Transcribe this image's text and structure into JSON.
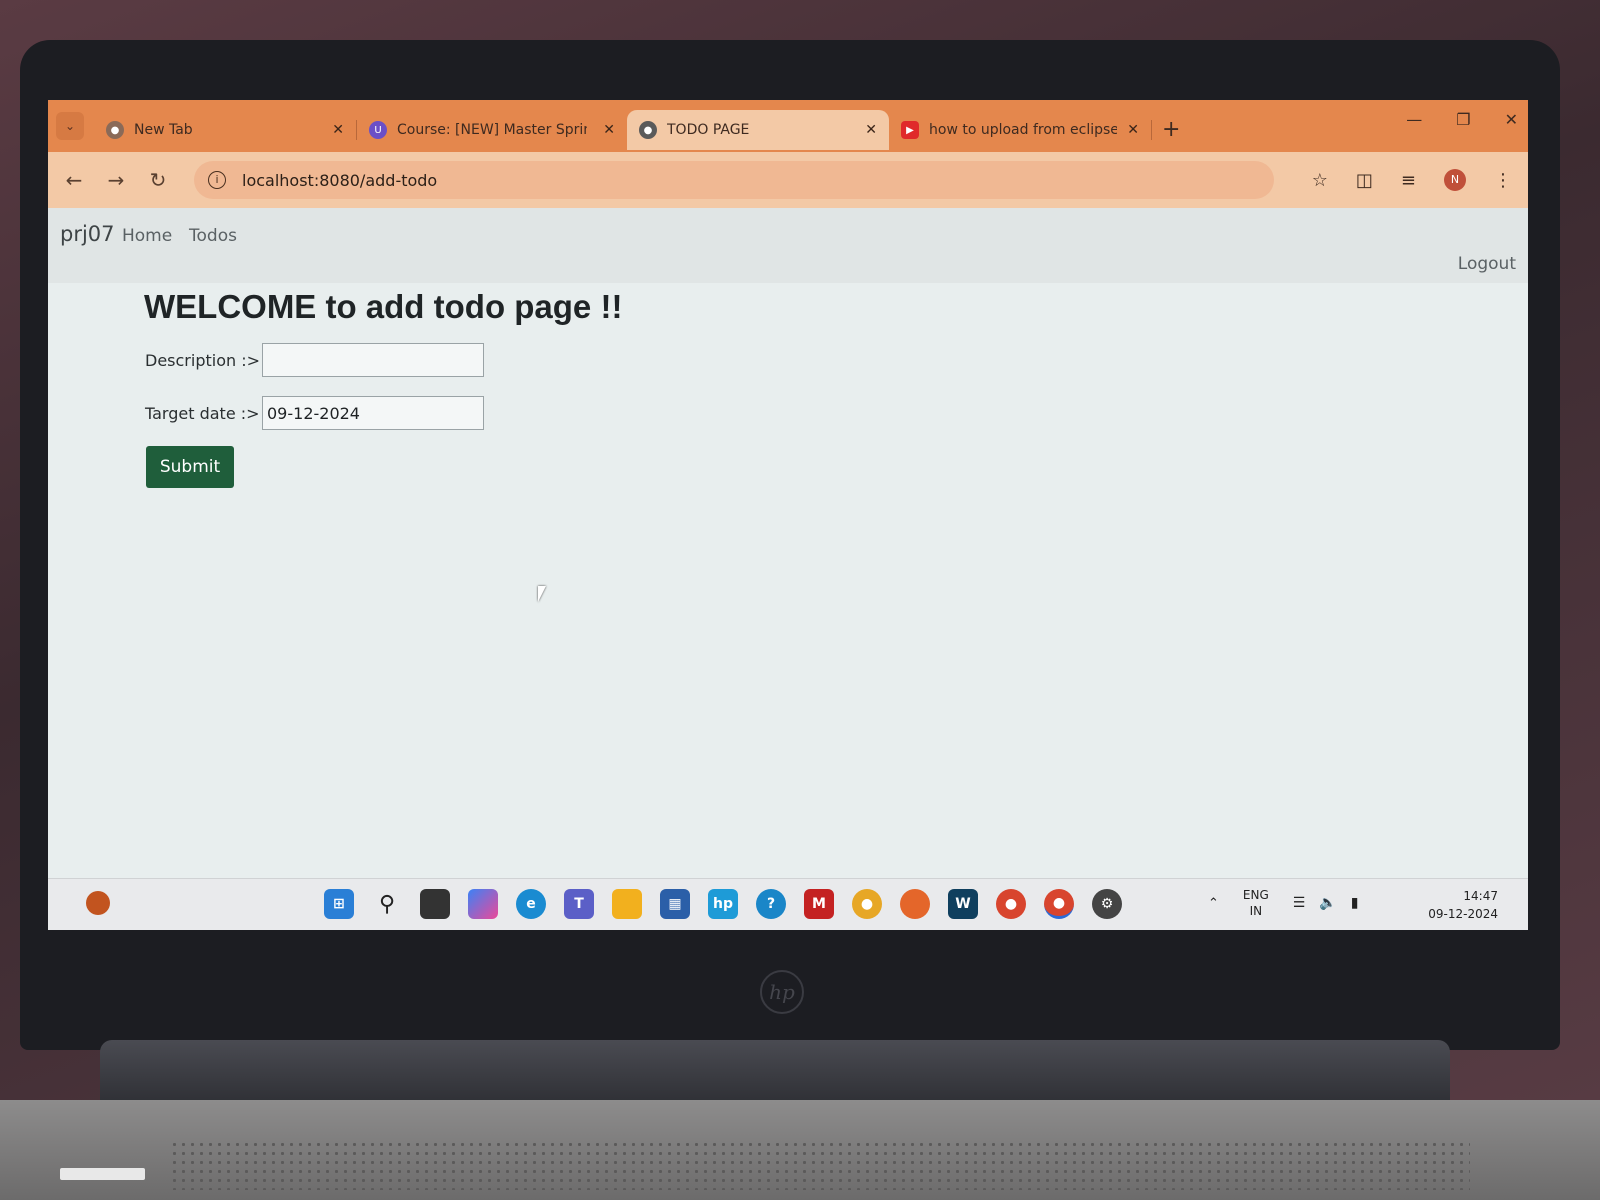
{
  "browser": {
    "tabs": [
      {
        "title": "New Tab",
        "active": false
      },
      {
        "title": "Course: [NEW] Master Spring B",
        "active": false
      },
      {
        "title": "TODO PAGE",
        "active": true
      },
      {
        "title": "how to upload from eclipse to",
        "active": false
      }
    ],
    "new_tab": "+",
    "address": "localhost:8080/add-todo"
  },
  "navbar": {
    "brand": "prj07",
    "links": [
      "Home",
      "Todos"
    ],
    "logout": "Logout"
  },
  "form": {
    "heading": "WELCOME to add todo page !!",
    "description_label": "Description :>",
    "description_value": "",
    "target_date_label": "Target date :>",
    "target_date_value": "09-12-2024",
    "submit_label": "Submit"
  },
  "taskbar": {
    "lang": "ENG",
    "region": "IN",
    "time": "14:47",
    "date": "09-12-2024"
  },
  "bezel_brand": "hp",
  "colors": {
    "tabstrip": "#e4874d",
    "toolbar": "#f3c9a6",
    "submit": "#1f5e3b"
  }
}
